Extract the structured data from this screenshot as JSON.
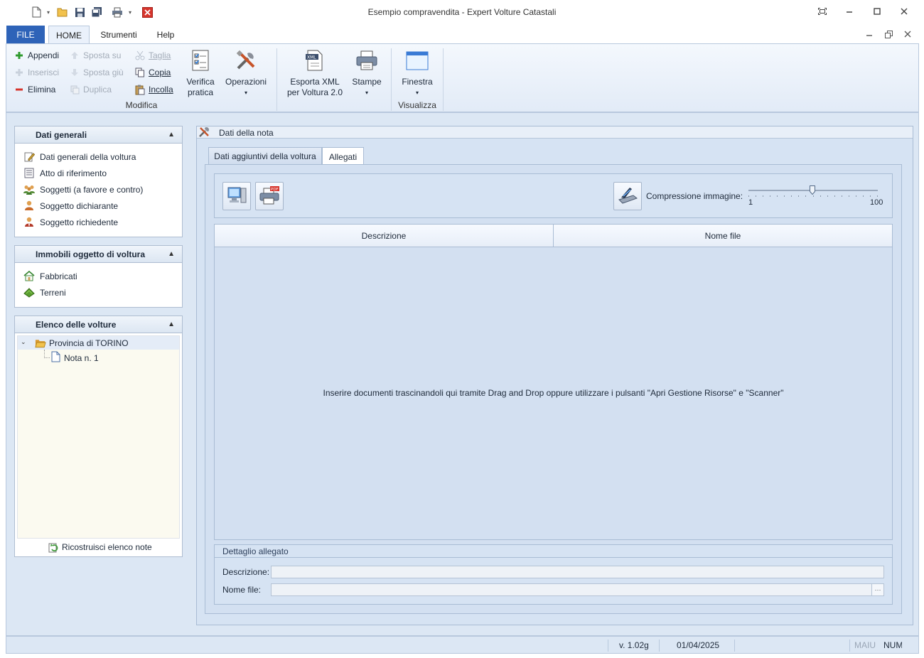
{
  "window": {
    "title": "Esempio compravendita - Expert Volture Catastali"
  },
  "ribbon": {
    "tabs": {
      "file": "FILE",
      "home": "HOME",
      "strumenti": "Strumenti",
      "help": "Help"
    },
    "modifica": {
      "appendi": "Appendi",
      "inserisci": "Inserisci",
      "elimina": "Elimina",
      "sposta_su": "Sposta su",
      "sposta_giu": "Sposta giù",
      "duplica": "Duplica",
      "taglia": "Taglia",
      "copia": "Copia",
      "incolla": "Incolla",
      "group_label": "Modifica"
    },
    "verifica_line1": "Verifica",
    "verifica_line2": "pratica",
    "operazioni": "Operazioni",
    "esporta_line1": "Esporta XML",
    "esporta_line2": "per Voltura 2.0",
    "stampe": "Stampe",
    "finestra": "Finestra",
    "visualizza_label": "Visualizza"
  },
  "sidebar": {
    "dati_generali": {
      "title": "Dati generali",
      "items": [
        "Dati generali della voltura",
        "Atto di riferimento",
        "Soggetti (a favore e contro)",
        "Soggetto dichiarante",
        "Soggetto richiedente"
      ]
    },
    "immobili": {
      "title": "Immobili oggetto di voltura",
      "items": [
        "Fabbricati",
        "Terreni"
      ]
    },
    "elenco": {
      "title": "Elenco delle volture",
      "tree_root": "Provincia di TORINO",
      "tree_child": "Nota n. 1",
      "rebuild": "Ricostruisci elenco note"
    }
  },
  "note_panel": {
    "title": "Dati della nota",
    "tabs": {
      "aggiuntivi": "Dati aggiuntivi della voltura",
      "allegati": "Allegati"
    },
    "compression_label": "Compressione immagine:",
    "slider_min": "1",
    "slider_max": "100",
    "slider_value": 50,
    "grid": {
      "columns": [
        "Descrizione",
        "Nome file"
      ],
      "empty_message": "Inserire documenti trascinandoli qui tramite Drag and Drop oppure utilizzare i pulsanti \"Apri Gestione Risorse\" e \"Scanner\""
    },
    "detail": {
      "title": "Dettaglio allegato",
      "descrizione_label": "Descrizione:",
      "descrizione_value": "",
      "nomefile_label": "Nome file:",
      "nomefile_value": "",
      "browse": "···"
    }
  },
  "statusbar": {
    "version": "v. 1.02g",
    "date": "01/04/2025",
    "caps": "MAIU",
    "num": "NUM"
  },
  "colors": {
    "file_tab": "#2e63b8",
    "main_bg": "#dce7f4",
    "panel_border": "#aebdd1"
  }
}
